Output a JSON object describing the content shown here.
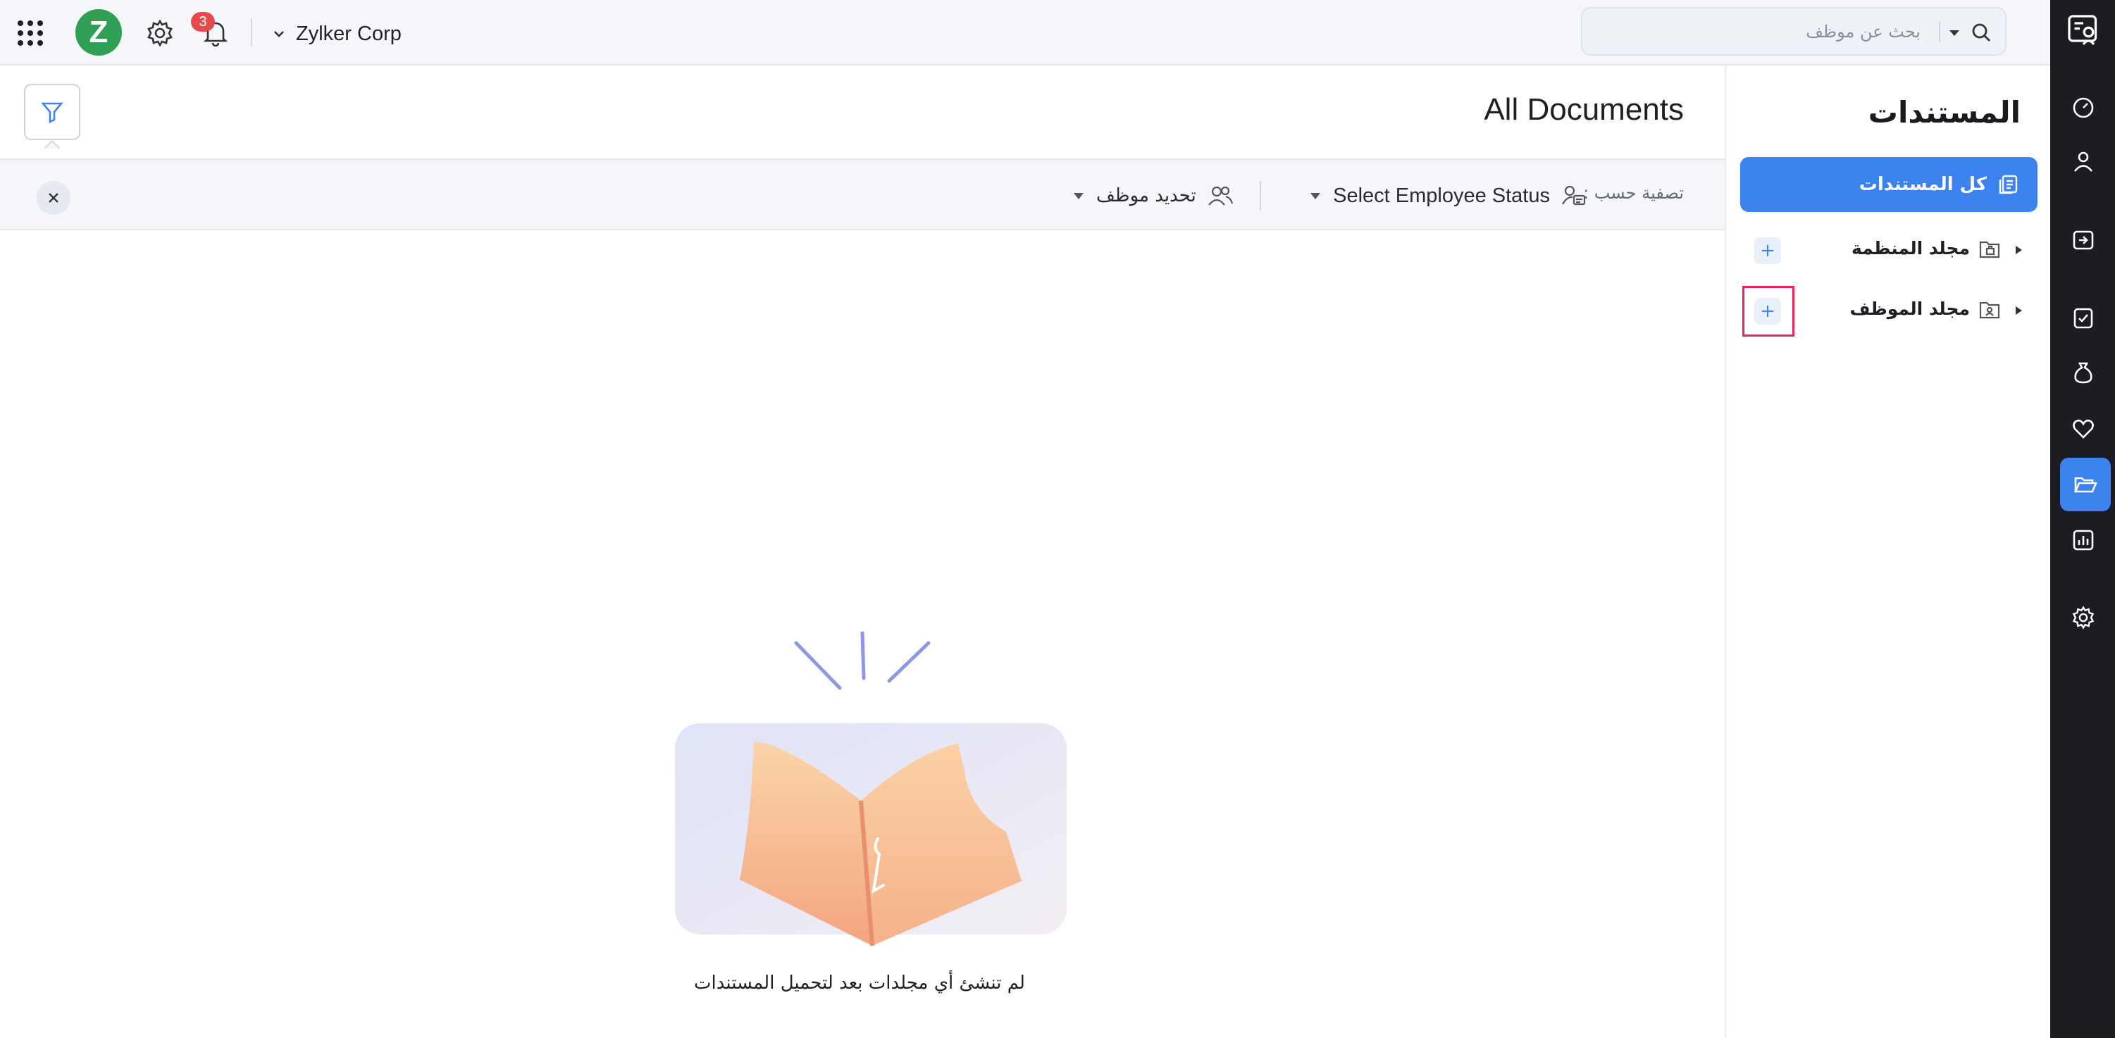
{
  "topbar": {
    "org_name": "Zylker Corp",
    "logo_letter": "Z",
    "notification_count": "3",
    "search_placeholder": "بحث عن موظف"
  },
  "nav": {
    "title": "المستندات",
    "all_documents": "كل المستندات",
    "folders": [
      {
        "label": "مجلد المنظمة",
        "add": "+"
      },
      {
        "label": "مجلد الموظف",
        "add": "+"
      }
    ]
  },
  "main": {
    "heading": "All Documents",
    "filter_label": "تصفية حسب :",
    "employee_status": "Select Employee Status",
    "select_employee": "تحديد موظف",
    "empty_message": "لم تنشئ أي مجلدات بعد لتحميل المستندات"
  },
  "rail": {
    "items": [
      "documents-app-icon",
      "dashboard-icon",
      "profile-icon",
      "check-in-icon",
      "tasks-icon",
      "payroll-icon",
      "engagement-icon",
      "folder-icon",
      "reports-icon",
      "settings-icon"
    ],
    "active": "folder-icon"
  },
  "colors": {
    "accent": "#3c83ef",
    "logo": "#2e9f53",
    "badge": "#e64b4b",
    "highlight": "#e8265d",
    "rail": "#1c1c22"
  }
}
